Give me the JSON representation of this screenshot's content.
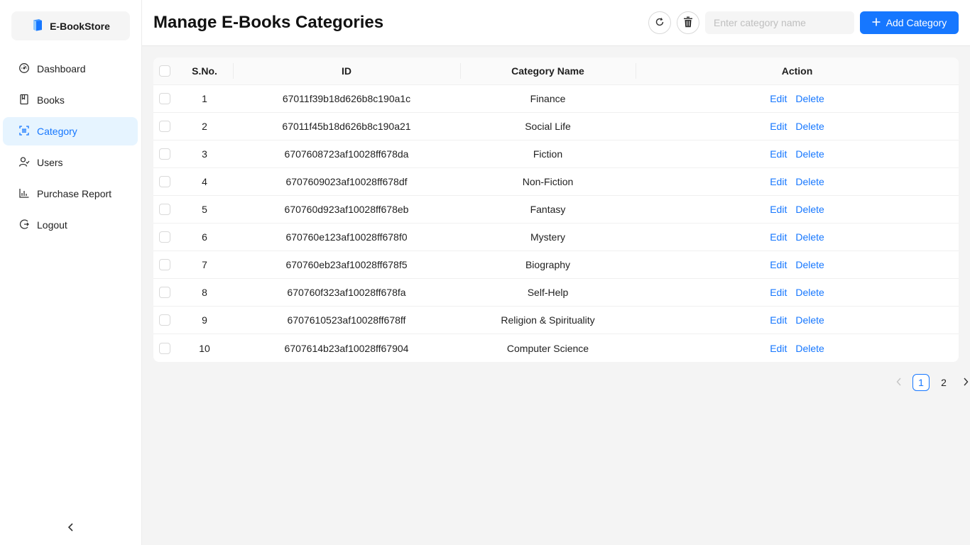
{
  "brand": {
    "name": "E-BookStore",
    "icon": "book-icon",
    "color": "#1677ff"
  },
  "sidebar": {
    "items": [
      {
        "label": "Dashboard",
        "icon": "dashboard-icon"
      },
      {
        "label": "Books",
        "icon": "book-outline-icon"
      },
      {
        "label": "Category",
        "icon": "category-icon",
        "active": true
      },
      {
        "label": "Users",
        "icon": "users-icon"
      },
      {
        "label": "Purchase Report",
        "icon": "bar-chart-icon"
      },
      {
        "label": "Logout",
        "icon": "logout-icon"
      }
    ],
    "collapse_icon": "chevron-left-icon"
  },
  "header": {
    "title": "Manage E-Books Categories",
    "search_placeholder": "Enter category name",
    "add_label": "Add Category",
    "accent": "#1677ff"
  },
  "table": {
    "columns": [
      "S.No.",
      "ID",
      "Category Name",
      "Action"
    ],
    "edit_label": "Edit",
    "delete_label": "Delete",
    "rows": [
      {
        "sno": "1",
        "id": "67011f39b18d626b8c190a1c",
        "name": "Finance"
      },
      {
        "sno": "2",
        "id": "67011f45b18d626b8c190a21",
        "name": "Social Life"
      },
      {
        "sno": "3",
        "id": "6707608723af10028ff678da",
        "name": "Fiction"
      },
      {
        "sno": "4",
        "id": "6707609023af10028ff678df",
        "name": "Non-Fiction"
      },
      {
        "sno": "5",
        "id": "670760d923af10028ff678eb",
        "name": "Fantasy"
      },
      {
        "sno": "6",
        "id": "670760e123af10028ff678f0",
        "name": "Mystery"
      },
      {
        "sno": "7",
        "id": "670760eb23af10028ff678f5",
        "name": "Biography"
      },
      {
        "sno": "8",
        "id": "670760f323af10028ff678fa",
        "name": "Self-Help"
      },
      {
        "sno": "9",
        "id": "6707610523af10028ff678ff",
        "name": "Religion & Spirituality"
      },
      {
        "sno": "10",
        "id": "6707614b23af10028ff67904",
        "name": "Computer Science"
      }
    ]
  },
  "pagination": {
    "pages": [
      "1",
      "2"
    ],
    "current": "1"
  }
}
